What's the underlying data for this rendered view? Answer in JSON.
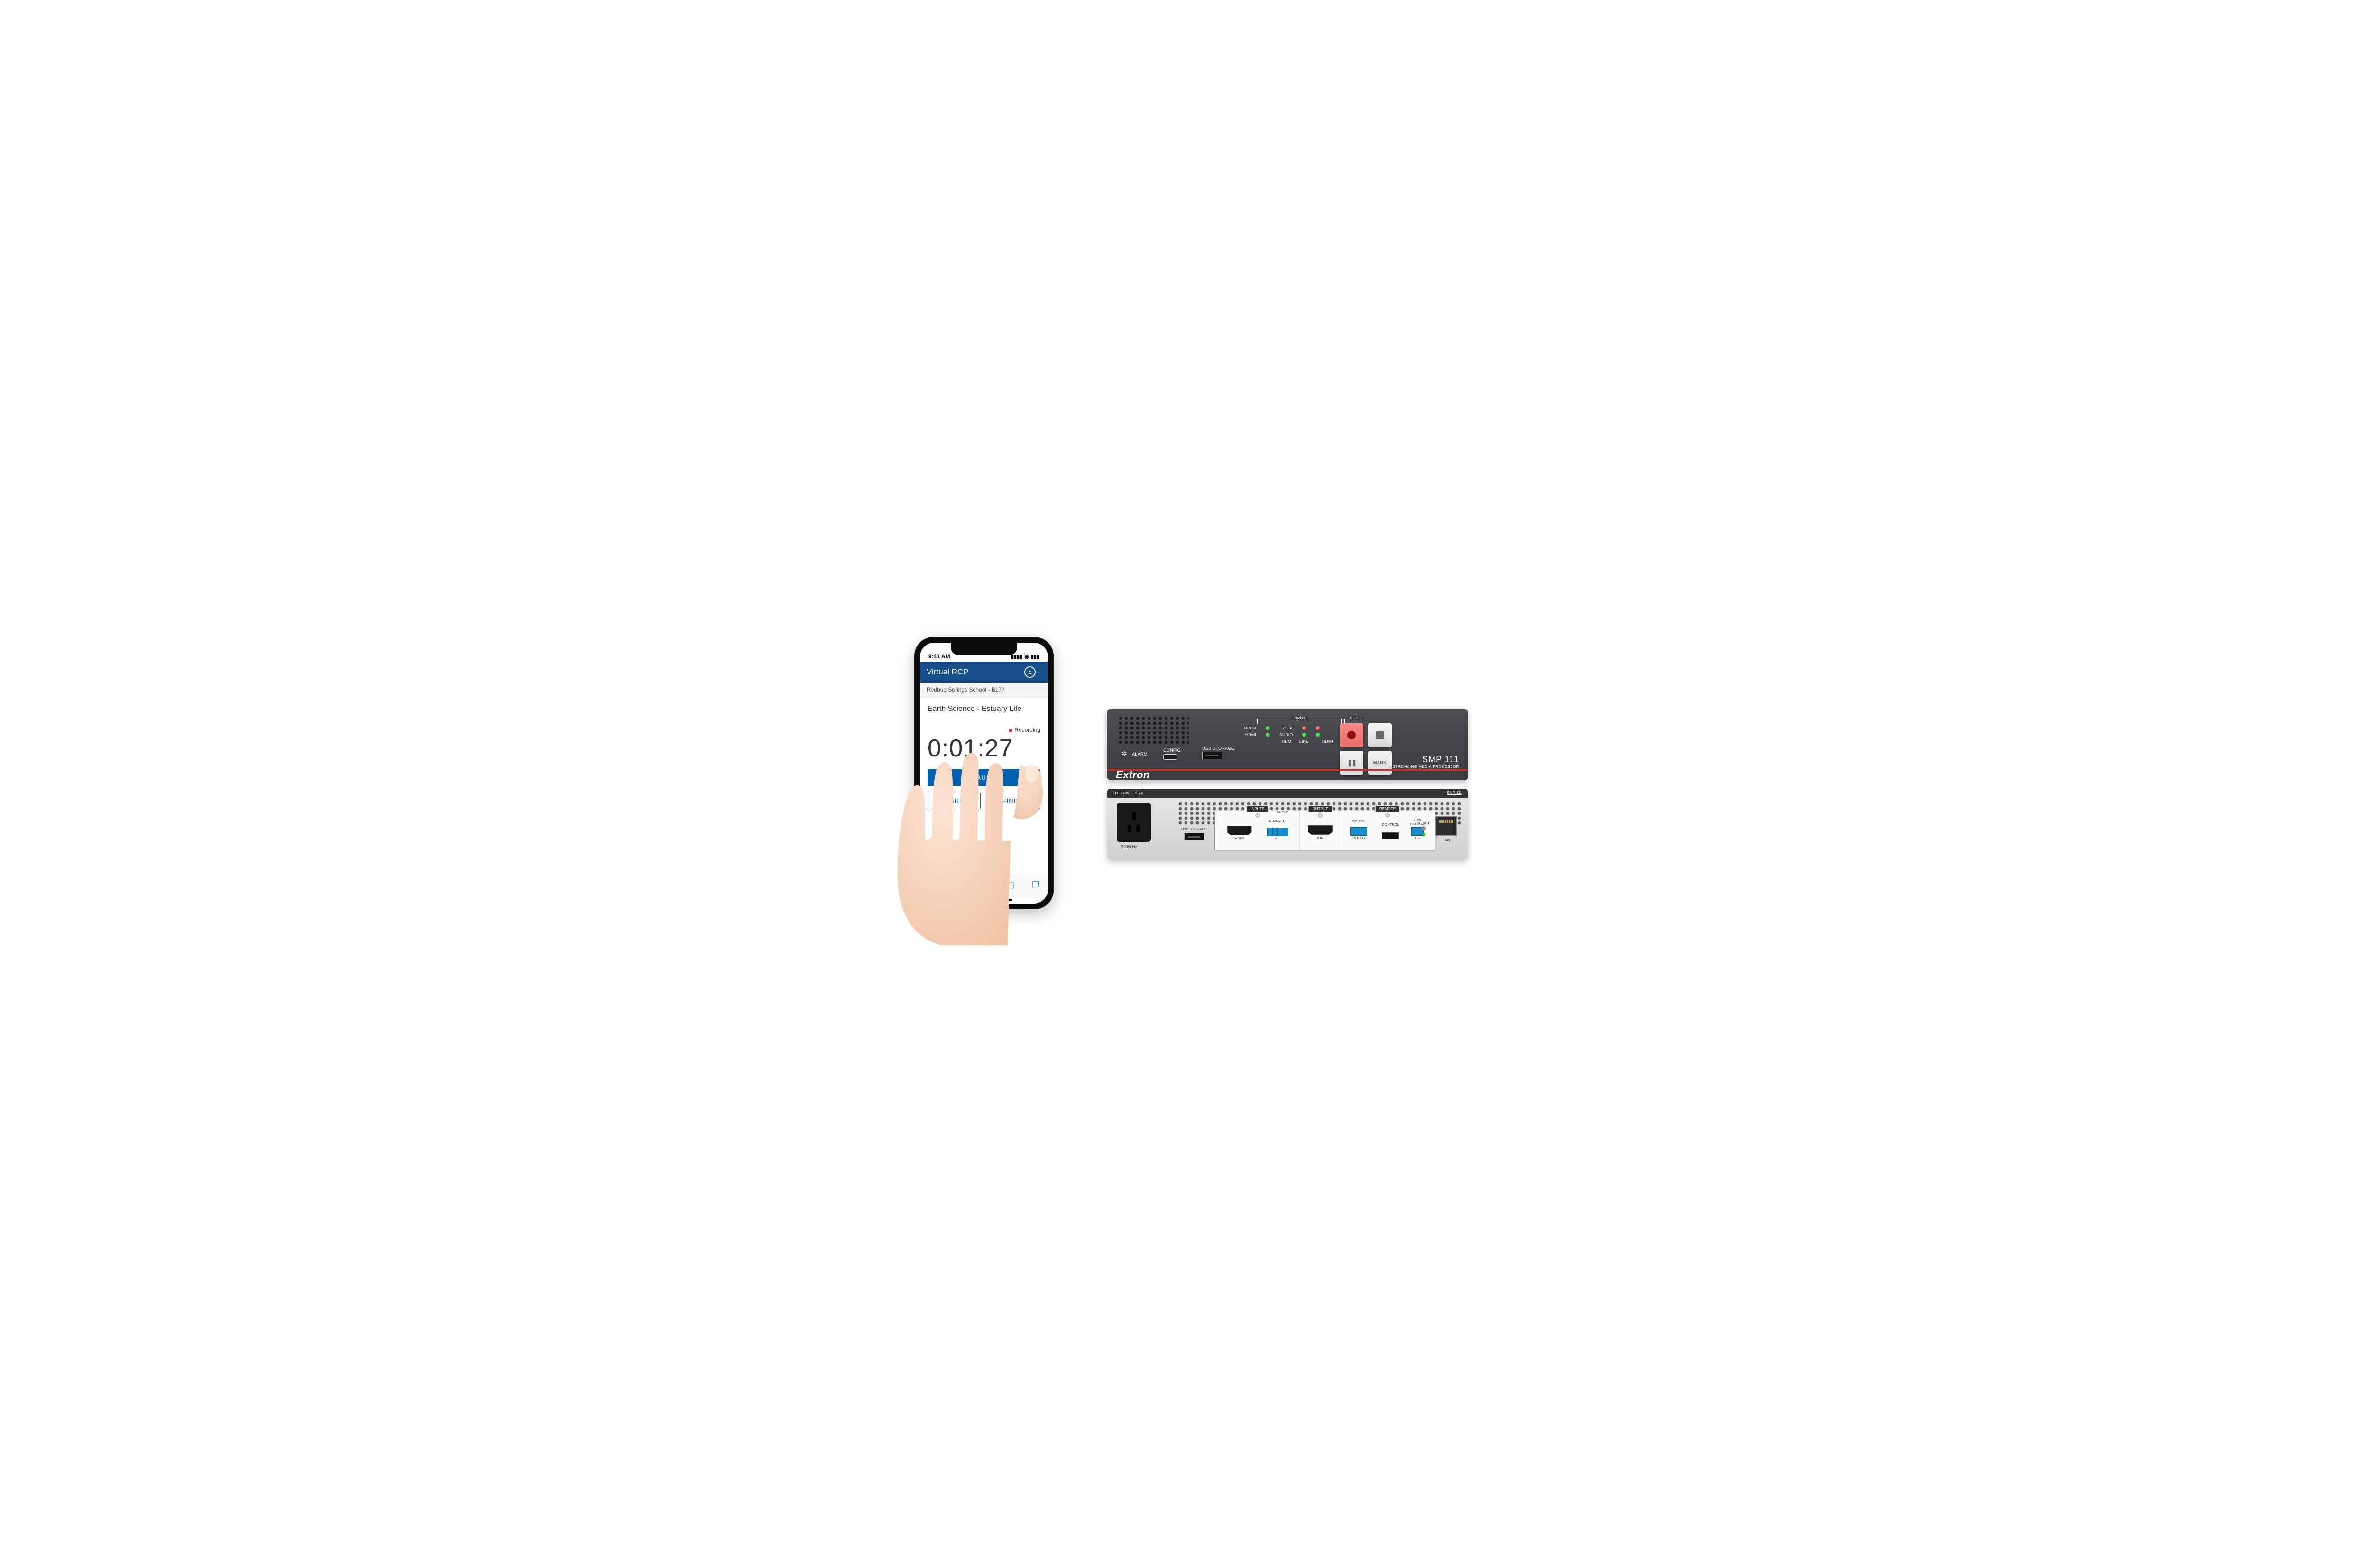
{
  "phone": {
    "status": {
      "time": "9:41 AM"
    },
    "app_title": "Virtual RCP",
    "location": "Redbud Springs School - B177",
    "lesson": "Earth Science - Estuary Life",
    "recording_status": "Recording",
    "timer": "0:01:27",
    "buttons": {
      "pause": "PAUSE",
      "mark": "MARK",
      "finish": "FINISH"
    }
  },
  "front": {
    "brand": "Extron",
    "alarm": "ALARM",
    "config": "CONFIG",
    "usb": "USB STORAGE",
    "model": "SMP 111",
    "subtitle": "STREAMING MEDIA PROCESSOR",
    "diag": {
      "input": "INPUT",
      "out": "OUT",
      "hdcp": "HDCP",
      "clip": "CLIP",
      "hdmi": "HDMI",
      "audio": "AUDIO",
      "line": "LINE"
    },
    "mark": "MARK"
  },
  "rear": {
    "power": "100-240V ～ 0.7A",
    "model": "SMP 111",
    "hz": "50-60 Hz",
    "usb": "USB STORAGE",
    "inputs": "INPUTS",
    "output": "OUTPUT",
    "remote": "REMOTE",
    "hdmi": "HDMI",
    "audio": "AUDIO",
    "audio_l": "L",
    "audio_line": "LINE",
    "audio_r": "R",
    "rs232": "RS-232",
    "control": "CONTROL",
    "txrxg": "Tx  Rx  G",
    "pm": "+  –",
    "v12": "+12V",
    "amp": "1.0A MAX",
    "reset": "RESET",
    "lan": "LAN"
  }
}
